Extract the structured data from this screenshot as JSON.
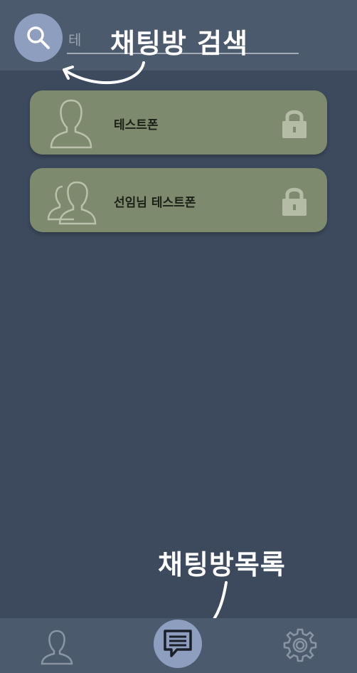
{
  "search": {
    "value": "테",
    "annotation": "채팅방 검색"
  },
  "rooms": [
    {
      "name": "테스트폰",
      "avatar_icon": "single-user-icon",
      "lock_icon": "lock-icon"
    },
    {
      "name": "선임님  테스트폰",
      "avatar_icon": "group-users-icon",
      "lock_icon": "lock-icon"
    }
  ],
  "bottom_nav": {
    "annotation": "채팅방목록",
    "items": [
      {
        "icon": "profile-icon",
        "active": false
      },
      {
        "icon": "chat-list-icon",
        "active": true
      },
      {
        "icon": "gear-icon",
        "active": false
      }
    ]
  },
  "colors": {
    "background": "#3d4a5e",
    "header": "#4c5a6d",
    "accent_circle": "#8e9ebe",
    "room_card": "#7d8a6e"
  }
}
